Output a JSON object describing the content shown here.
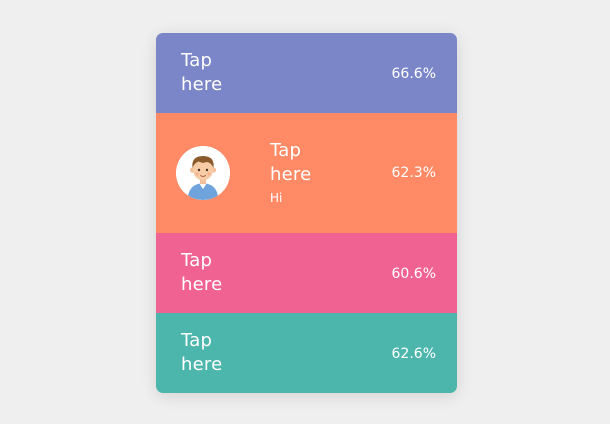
{
  "rows": [
    {
      "label": "Tap here",
      "percent": "66.6%",
      "color": "#7b86c8"
    },
    {
      "label": "Tap here",
      "sublabel": "Hi",
      "percent": "62.3%",
      "color": "#ff8a65",
      "avatar": "boy-avatar-icon"
    },
    {
      "label": "Tap here",
      "percent": "60.6%",
      "color": "#f06292"
    },
    {
      "label": "Tap here",
      "percent": "62.6%",
      "color": "#4db6ac"
    }
  ]
}
